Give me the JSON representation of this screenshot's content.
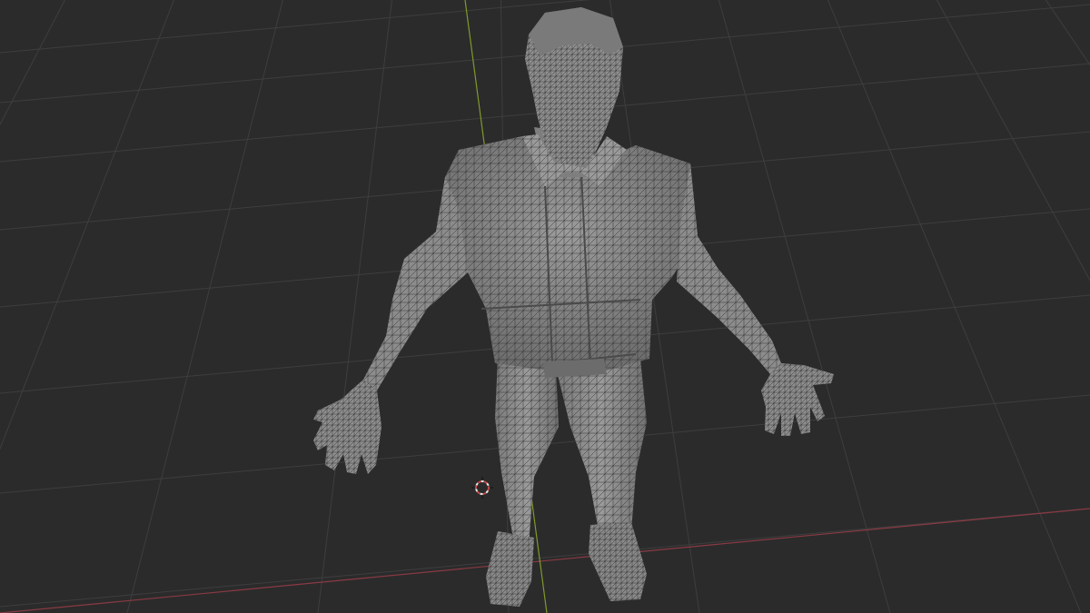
{
  "viewport": {
    "mode": "3d-viewport",
    "shading": "solid-wireframe-overlay",
    "object": "character-mesh"
  },
  "colors": {
    "background": "#2b2b2b",
    "grid": "#3e3e3e",
    "x_axis": "#8a3a44",
    "y_axis": "#7e9a2a",
    "mesh_fill": "#8e8e8e",
    "mesh_shadow": "#5a5a5a",
    "wire": "#2a2a2a",
    "cursor_red": "#c64848",
    "cursor_white": "#e6e6e6"
  }
}
